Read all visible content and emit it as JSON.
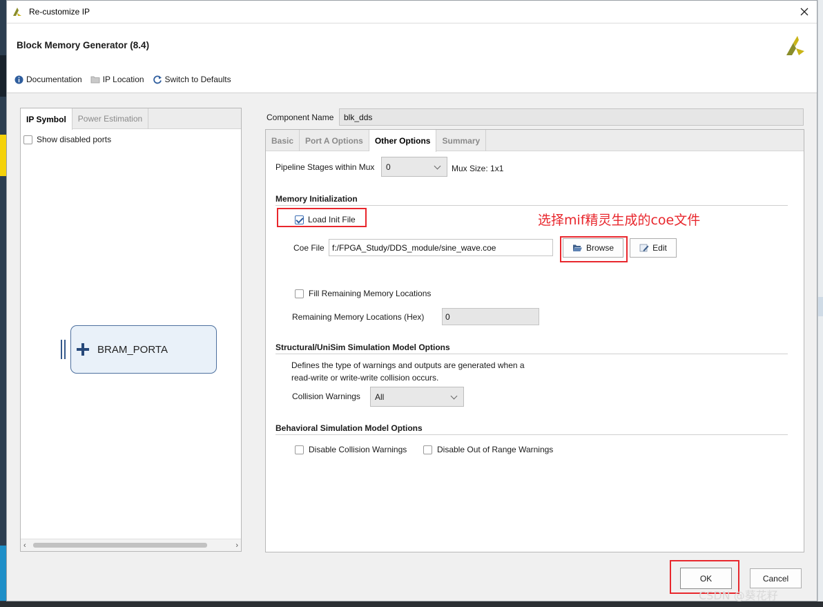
{
  "window": {
    "title": "Re-customize IP"
  },
  "header": {
    "ip_title": "Block Memory Generator (8.4)",
    "toolbar": {
      "documentation": "Documentation",
      "ip_location": "IP Location",
      "switch_defaults": "Switch to Defaults"
    }
  },
  "left_panel": {
    "tabs": [
      "IP Symbol",
      "Power Estimation"
    ],
    "show_disabled_ports": "Show disabled ports",
    "port_label": "BRAM_PORTA"
  },
  "component": {
    "label": "Component Name",
    "value": "blk_dds"
  },
  "tabs": [
    "Basic",
    "Port A Options",
    "Other Options",
    "Summary"
  ],
  "other_options": {
    "pipeline_label": "Pipeline Stages within Mux",
    "pipeline_value": "0",
    "mux_size": "Mux Size: 1x1",
    "memory_init": {
      "heading": "Memory Initialization",
      "load_init_label": "Load Init File",
      "load_init_checked": true,
      "coe_label": "Coe File",
      "coe_value": "f:/FPGA_Study/DDS_module/sine_wave.coe",
      "browse": "Browse",
      "edit": "Edit",
      "fill_remaining_label": "Fill Remaining Memory Locations",
      "remaining_label": "Remaining Memory Locations (Hex)",
      "remaining_value": "0"
    },
    "structural": {
      "heading": "Structural/UniSim Simulation Model Options",
      "desc_line1": "Defines the type of warnings and outputs are generated when a",
      "desc_line2": "read-write or write-write collision occurs.",
      "collision_label": "Collision Warnings",
      "collision_value": "All"
    },
    "behavioral": {
      "heading": "Behavioral Simulation Model Options",
      "disable_collision": "Disable Collision Warnings",
      "disable_range": "Disable Out of Range Warnings"
    }
  },
  "footer": {
    "ok": "OK",
    "cancel": "Cancel"
  },
  "annotation": {
    "text": "选择mif精灵生成的coe文件",
    "color": "#e8262c"
  },
  "watermark": "CSDN @葵花籽",
  "colors": {
    "accent": "#2f5e9e",
    "highlight_red": "#e8262c"
  }
}
